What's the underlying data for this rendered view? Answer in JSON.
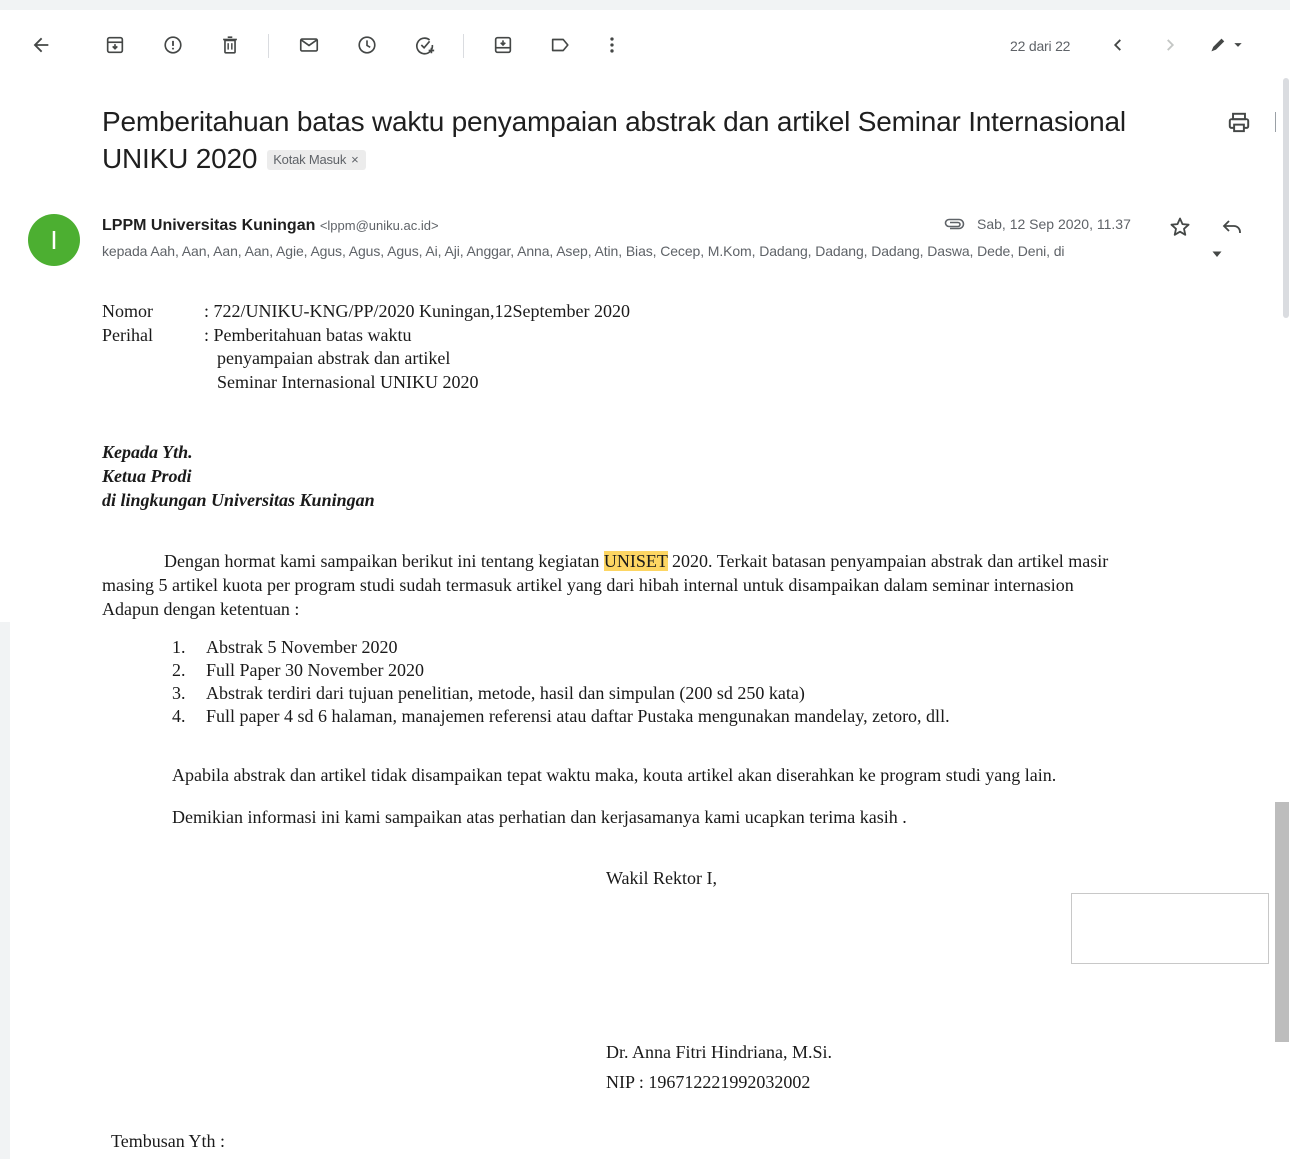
{
  "toolbar": {
    "counter": "22 dari 22",
    "icons": [
      "back-arrow-icon",
      "archive-icon",
      "report-spam-icon",
      "delete-icon",
      "mark-unread-icon",
      "snooze-icon",
      "add-task-icon",
      "move-to-icon",
      "label-icon",
      "more-vert-icon",
      "chevron-left-icon",
      "chevron-right-icon",
      "pen-icon"
    ]
  },
  "email": {
    "subject": "Pemberitahuan batas waktu penyampaian abstrak dan artikel Seminar Internasional UNIKU 2020",
    "label": "Kotak Masuk",
    "label_close": "×",
    "sender_name": "LPPM Universitas Kuningan",
    "sender_email": "<lppm@uniku.ac.id>",
    "avatar_letter": "I",
    "date": "Sab, 12 Sep 2020, 11.37",
    "recipients": "kepada Aah, Aan, Aan, Aan, Agie, Agus, Agus, Agus, Ai, Aji, Anggar, Anna, Asep, Atin, Bias, Cecep, M.Kom, Dadang, Dadang, Dadang, Daswa, Dede, Deni, di"
  },
  "letter": {
    "nomor_label": "Nomor",
    "nomor_value": ":  722/UNIKU-KNG/PP/2020 Kuningan,12September 2020",
    "perihal_label": "Perihal",
    "perihal_line1": ":  Pemberitahuan batas waktu",
    "perihal_line2": "penyampaian abstrak dan artikel",
    "perihal_line3": "Seminar Internasional UNIKU 2020",
    "addr1": "Kepada Yth.",
    "addr2": "Ketua Prodi",
    "addr3": "di lingkungan Universitas Kuningan",
    "para_before": "Dengan hormat kami sampaikan berikut ini tentang kegiatan ",
    "para_highlight": "UNISET",
    "para_after": " 2020. Terkait batasan penyampaian abstrak dan artikel masir",
    "para_line2": "masing 5 artikel kuota per program studi sudah termasuk artikel yang dari hibah internal untuk disampaikan dalam seminar internasion",
    "para_line3": "Adapun dengan ketentuan :",
    "list": [
      {
        "num": "1.",
        "text": "Abstrak 5 November 2020"
      },
      {
        "num": "2.",
        "text": "Full Paper 30 November 2020"
      },
      {
        "num": "3.",
        "text": "Abstrak terdiri dari tujuan penelitian, metode, hasil  dan simpulan (200 sd 250 kata)"
      },
      {
        "num": "4.",
        "text": "Full paper 4 sd 6 halaman, manajemen referensi atau daftar Pustaka mengunakan mandelay, zetoro, dll."
      }
    ],
    "note": "Apabila abstrak dan artikel tidak disampaikan tepat waktu maka, kouta artikel akan diserahkan ke program studi yang lain.",
    "closing": "Demikian informasi ini kami sampaikan atas perhatian dan kerjasamanya kami ucapkan terima kasih .",
    "signer_title": "Wakil Rektor I,",
    "signer_name": "Dr. Anna Fitri Hindriana, M.Si.",
    "signer_nip": "NIP : 196712221992032002",
    "cc": "Tembusan Yth :"
  }
}
